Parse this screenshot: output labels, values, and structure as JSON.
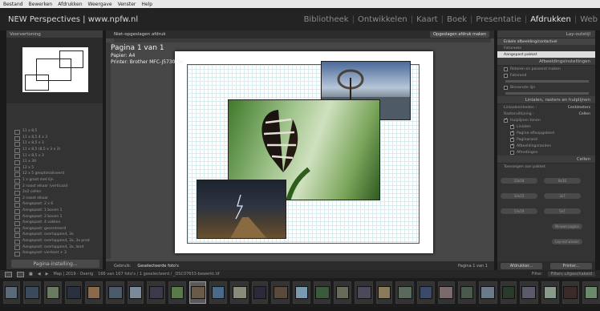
{
  "menubar": [
    "Bestand",
    "Bewerken",
    "Afdrukken",
    "Weergave",
    "Venster",
    "Help"
  ],
  "app_title": "NEW Perspectives | www.npfw.nl",
  "modules": [
    "Bibliotheek",
    "Ontwikkelen",
    "Kaart",
    "Boek",
    "Presentatie",
    "Afdrukken",
    "Web"
  ],
  "active_module": "Afdrukken",
  "left": {
    "preview_header": "Voorvertoning",
    "template_items": [
      "11 x 8,5",
      "11 x 8,5 4 x 3",
      "11 x 8,5 x 3",
      "11 x 8,5 (8,5 x 3 x 3)",
      "11 x 8,5 x 3",
      "11 x 30",
      "12 x 5",
      "12 x 5 geoptimaliseerd",
      "1 x groot met lijn",
      "2 naast elkaar (verticaal)",
      "2x2 cellen",
      "2 naast elkaar",
      "Aangepast: 2 x 6",
      "Aangepast: 1 boven 1",
      "Aangepast: 2 boven 1",
      "Aangepast: 4 vakken",
      "Aangepast: gecentreerd",
      "Aangepast: overlappend, 3x",
      "Aangepast: overlappend, 3x, 3x prod",
      "Aangepast: overlappend, 3x, land",
      "Aangepast: vierkant + 3"
    ],
    "page_setup_button": "Pagina-instelling..."
  },
  "center": {
    "header": "Niet-opgeslagen afdruk",
    "save_button": "Opgeslagen afdruk maken",
    "overlay_page": "Pagina 1 van 1",
    "overlay_paper": "Papier: A4",
    "overlay_printer": "Printer: Brother MFC-J5730DW ...",
    "toolbar_use": "Gebruik:",
    "toolbar_selection": "Geselecteerde foto's",
    "toolbar_page": "Pagina 1 van 1"
  },
  "right": {
    "layout_style": "Lay-outstijl",
    "styles": [
      "Enkele afbeelding/contactvel",
      "Fotoreeks",
      "Aangepast pakket"
    ],
    "section_image_settings": "Afbeeldingsinstellingen",
    "image_options": [
      "Roteren en passend maken",
      "Fotorand",
      "Binnenste lijn"
    ],
    "section_rulers": "Linialen, rasters en hulplijnen",
    "ruler_units": "Liniaaleenheden :",
    "ruler_unit_value": "Centimeters",
    "grid_snap": "Rasteruitlijning :",
    "grid_snap_value": "Cellen",
    "guides_title": "Hulplijnen tonen",
    "guides": [
      "Linialen",
      "Pagina-afloopgebied",
      "Paginarand",
      "Afbeeldingsranden",
      "Afmetingen"
    ],
    "section_cells": "Cellen",
    "add_to_package": "Toevoegen aan pakket",
    "cell_sizes": [
      "13x18",
      "8x10",
      "10x15",
      "3x7",
      "13x19",
      "5x7"
    ],
    "new_page": "Nieuwe pagina",
    "clear_layout": "Lay-out wissen",
    "print_button": "Afdrukker...",
    "print_now": "Printer..."
  },
  "filmstrip": {
    "source": "Map | 2019 - Overig",
    "count": "166 van 167 foto's / 1 geselecteerd / _DSC07653-bewerkt.tif",
    "filter_label": "Filter:",
    "filter_value": "Filters uitgeschakeld"
  },
  "colors": {
    "accent": "#e6e6e6",
    "panel": "#333333",
    "background": "#1a1a1a"
  }
}
